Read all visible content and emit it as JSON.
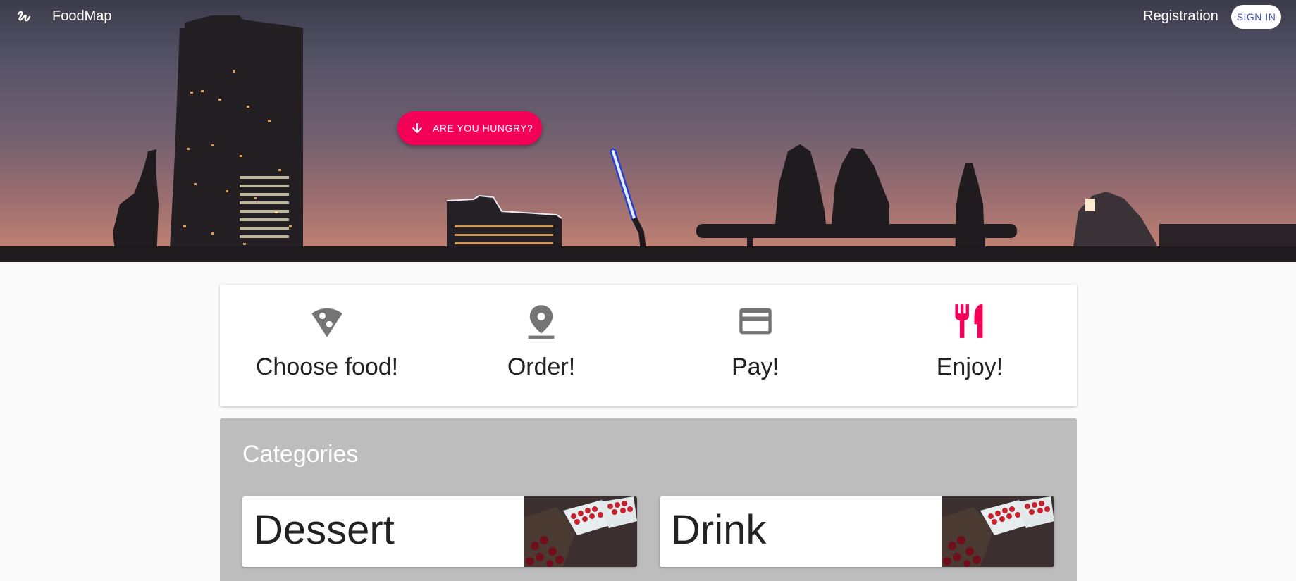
{
  "nav": {
    "brand": "FoodMap",
    "logo_icon": "squiggle-logo-icon",
    "registration": "Registration",
    "sign_in": "SIGN IN"
  },
  "hero": {
    "cta_label": "ARE YOU HUNGRY?",
    "cta_icon": "arrow-down-icon",
    "cta_color": "#f50057"
  },
  "steps": [
    {
      "label": "Choose food!",
      "icon": "pizza-slice-icon",
      "color": "#757575"
    },
    {
      "label": "Order!",
      "icon": "map-pin-icon",
      "color": "#757575"
    },
    {
      "label": "Pay!",
      "icon": "credit-card-icon",
      "color": "#757575"
    },
    {
      "label": "Enjoy!",
      "icon": "fork-knife-icon",
      "color": "#f50057"
    }
  ],
  "categories": {
    "title": "Categories",
    "items": [
      {
        "name": "Dessert",
        "image": "berries-photo"
      },
      {
        "name": "Drink",
        "image": "berries-photo"
      }
    ]
  }
}
